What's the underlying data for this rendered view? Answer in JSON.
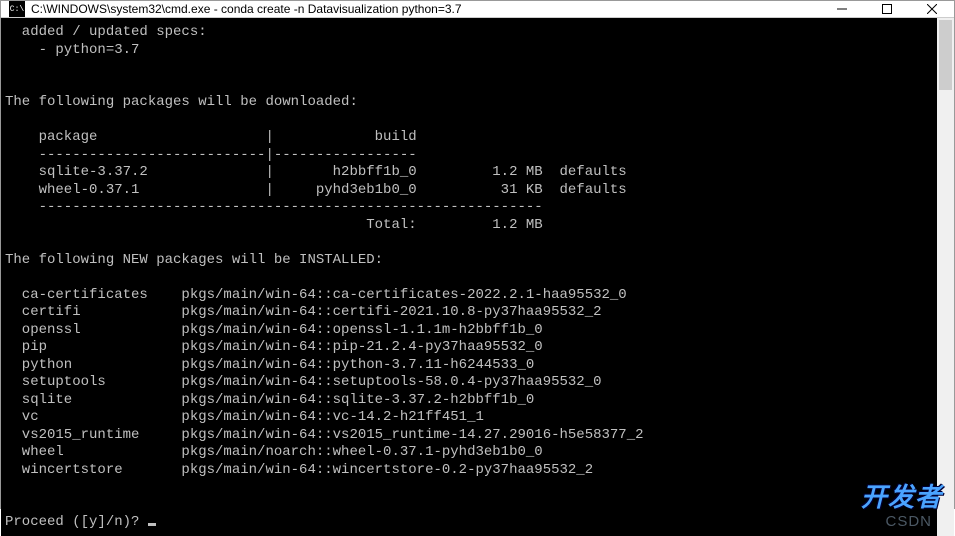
{
  "window": {
    "icon_text": "C:\\",
    "title": "C:\\WINDOWS\\system32\\cmd.exe - conda  create -n Datavisualization python=3.7"
  },
  "terminal": {
    "specs_header": "  added / updated specs:",
    "specs_item": "    - python=3.7",
    "dl_header": "The following packages will be downloaded:",
    "tbl_hdr_pkg": "    package                    |            build",
    "tbl_rule": "    ---------------------------|-----------------",
    "tbl_row1": "    sqlite-3.37.2              |       h2bbff1b_0         1.2 MB  defaults",
    "tbl_row2": "    wheel-0.37.1               |     pyhd3eb1b0_0          31 KB  defaults",
    "tbl_rule2": "    ------------------------------------------------------------",
    "tbl_total": "                                           Total:         1.2 MB",
    "inst_header": "The following NEW packages will be INSTALLED:",
    "pkg01": "  ca-certificates    pkgs/main/win-64::ca-certificates-2022.2.1-haa95532_0",
    "pkg02": "  certifi            pkgs/main/win-64::certifi-2021.10.8-py37haa95532_2",
    "pkg03": "  openssl            pkgs/main/win-64::openssl-1.1.1m-h2bbff1b_0",
    "pkg04": "  pip                pkgs/main/win-64::pip-21.2.4-py37haa95532_0",
    "pkg05": "  python             pkgs/main/win-64::python-3.7.11-h6244533_0",
    "pkg06": "  setuptools         pkgs/main/win-64::setuptools-58.0.4-py37haa95532_0",
    "pkg07": "  sqlite             pkgs/main/win-64::sqlite-3.37.2-h2bbff1b_0",
    "pkg08": "  vc                 pkgs/main/win-64::vc-14.2-h21ff451_1",
    "pkg09": "  vs2015_runtime     pkgs/main/win-64::vs2015_runtime-14.27.29016-h5e58377_2",
    "pkg10": "  wheel              pkgs/main/noarch::wheel-0.37.1-pyhd3eb1b0_0",
    "pkg11": "  wincertstore       pkgs/main/win-64::wincertstore-0.2-py37haa95532_2",
    "prompt": "Proceed ([y]/n)? "
  },
  "watermarks": {
    "csdn": "CSDN",
    "dev": "开发者"
  }
}
